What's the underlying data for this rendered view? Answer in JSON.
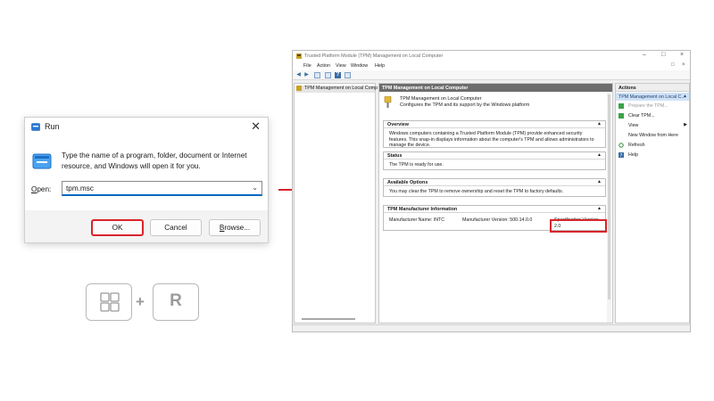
{
  "run_dialog": {
    "title": "Run",
    "description": "Type the name of a program, folder, document or Internet resource, and Windows will open it for you.",
    "open_label_underlined": "O",
    "open_label_rest": "pen:",
    "open_value": "tpm.msc",
    "ok_label": "OK",
    "cancel_label": "Cancel",
    "browse_label_underlined": "B",
    "browse_label_rest": "rowse...",
    "close_icon": "✕"
  },
  "shortcut": {
    "windows_key": "windows-logo-icon",
    "plus": "+",
    "r_key": "R"
  },
  "colors": {
    "highlight_red": "#d9242a",
    "accent_blue": "#0067c0",
    "header_gray": "#6d6d6d",
    "actions_selected": "#cfe2f7"
  },
  "tpm_window": {
    "title": "Trusted Platform Module (TPM) Management on Local Computer",
    "menu": [
      "File",
      "Action",
      "View",
      "Window",
      "Help"
    ],
    "tree_item": "TPM Management on Local Comp",
    "main_header": "TPM Management on Local Computer",
    "hero_line1": "TPM Management on Local Computer",
    "hero_line2": "Configures the TPM and its support by the Windows platform",
    "overview_title": "Overview",
    "overview_text": "Windows computers containing a Trusted Platform Module (TPM) provide enhanced security features. This snap-in displays information about the computer's TPM and allows administrators to manage the device.",
    "status_title": "Status",
    "status_text": "The TPM is ready for use.",
    "options_title": "Available Options",
    "options_text": "You may clear the TPM to remove ownership and reset the TPM to factory defaults.",
    "manufacturer_title": "TPM Manufacturer Information",
    "manufacturer_name": "Manufacturer Name:  INTC",
    "manufacturer_version": "Manufacturer Version:  500.14.0.0",
    "spec_version": "Specification Version:  2.0",
    "actions_title": "Actions",
    "actions_selected": "TPM Management on Local C...",
    "actions": [
      {
        "label": "Prepare the TPM...",
        "icon": "prepare-icon",
        "disabled": true
      },
      {
        "label": "Clear TPM...",
        "icon": "clear-icon",
        "disabled": false
      },
      {
        "label": "View",
        "icon": "",
        "disabled": false
      },
      {
        "label": "New Window from Here",
        "icon": "",
        "disabled": false
      },
      {
        "label": "Refresh",
        "icon": "refresh-icon",
        "disabled": false
      },
      {
        "label": "Help",
        "icon": "help-icon",
        "disabled": false
      }
    ]
  }
}
